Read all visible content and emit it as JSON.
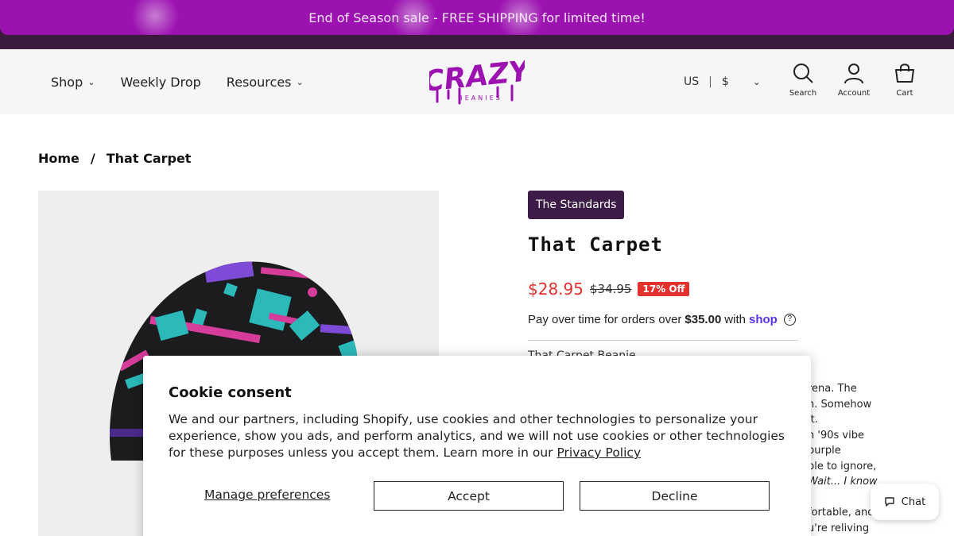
{
  "announcement": {
    "text": "End of Season sale - FREE SHIPPING for limited time!"
  },
  "nav": {
    "items": [
      {
        "label": "Shop",
        "has_dropdown": true
      },
      {
        "label": "Weekly Drop",
        "has_dropdown": false
      },
      {
        "label": "Resources",
        "has_dropdown": true
      }
    ]
  },
  "logo": {
    "text": "CRAZY",
    "subtext": "BEANIES",
    "color": "#9b12b0"
  },
  "locale": {
    "country": "US",
    "separator": "|",
    "currency": "$"
  },
  "header_icons": [
    {
      "label": "Search",
      "icon": "search-icon"
    },
    {
      "label": "Account",
      "icon": "user-icon"
    },
    {
      "label": "Cart",
      "icon": "cart-icon"
    }
  ],
  "breadcrumb": {
    "home": "Home",
    "separator": "/",
    "current": "That Carpet"
  },
  "product": {
    "collection_tag": "The Standards",
    "title": "That Carpet",
    "price": "$28.95",
    "compare_price": "$34.95",
    "discount_badge": "17% Off",
    "installments": {
      "prefix": "Pay over time for orders over",
      "amount": "$35.00",
      "with": "with",
      "provider": "shop",
      "help": "?"
    },
    "description_heading": "That Carpet Beanie",
    "description_lines": [
      "rena. The",
      "n. Somehow",
      " it.",
      "n '90s vibe",
      "purple",
      "ble to ignore,",
      "Wait... I know",
      "",
      "fortable, and",
      "u're reliving"
    ]
  },
  "cookie": {
    "title": "Cookie consent",
    "body": "We and our partners, including Shopify, use cookies and other technologies to personalize your experience, show you ads, and perform analytics, and we will not use cookies or other technologies for these purposes unless you accept them. Learn more in our",
    "policy_link": "Privacy Policy",
    "manage": "Manage preferences",
    "accept": "Accept",
    "decline": "Decline"
  },
  "chat": {
    "label": "Chat"
  },
  "colors": {
    "brand_purple": "#9b12b0",
    "dark_purple": "#3a1b3d",
    "sale_red": "#e3312d",
    "shop_pay": "#5a31f4"
  }
}
